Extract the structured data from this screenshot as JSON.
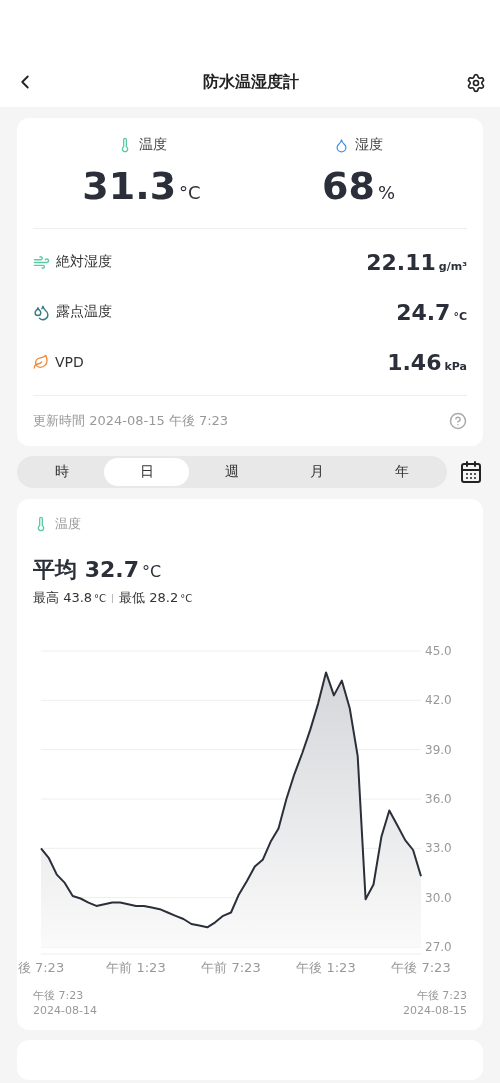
{
  "header": {
    "title": "防水温湿度計"
  },
  "current": [
    {
      "kind": "temperature",
      "label": "温度",
      "value": "31.3",
      "unit": "°C"
    },
    {
      "kind": "humidity",
      "label": "湿度",
      "value": "68",
      "unit": "%"
    }
  ],
  "metrics": [
    {
      "kind": "absolute_humidity",
      "label": "絶対湿度",
      "value": "22.11",
      "unit": "g/m³"
    },
    {
      "kind": "dew_point",
      "label": "露点温度",
      "value": "24.7",
      "unit": "°C"
    },
    {
      "kind": "vpd",
      "label": "VPD",
      "value": "1.46",
      "unit": "kPa"
    }
  ],
  "updated": "更新時間 2024-08-15 午後 7:23",
  "tabs": [
    {
      "label": "時",
      "selected": false
    },
    {
      "label": "日",
      "selected": true
    },
    {
      "label": "週",
      "selected": false
    },
    {
      "label": "月",
      "selected": false
    },
    {
      "label": "年",
      "selected": false
    }
  ],
  "chart_card": {
    "label": "温度",
    "average_label": "平均",
    "average_value": "32.7",
    "average_unit": "°C",
    "max_label": "最高",
    "max_value": "43.8",
    "max_unit": "°C",
    "min_label": "最低",
    "min_value": "28.2",
    "min_unit": "°C",
    "chart_data": {
      "type": "area",
      "grid": true,
      "ylim": [
        27,
        45
      ],
      "categories": [
        "後 7:23",
        null,
        null,
        null,
        null,
        null,
        null,
        null,
        null,
        null,
        null,
        null,
        "午前 1:23",
        null,
        null,
        null,
        null,
        null,
        null,
        null,
        null,
        null,
        null,
        null,
        "午前 7:23",
        null,
        null,
        null,
        null,
        null,
        null,
        null,
        null,
        null,
        null,
        null,
        "午後 1:23",
        null,
        null,
        null,
        null,
        null,
        null,
        null,
        null,
        null,
        null,
        null,
        "午後 7:23"
      ],
      "values": [
        33.0,
        32.4,
        31.4,
        30.9,
        30.1,
        29.95,
        29.7,
        29.5,
        29.6,
        29.7,
        29.7,
        29.6,
        29.5,
        29.5,
        29.4,
        29.3,
        29.1,
        28.9,
        28.7,
        28.4,
        28.3,
        28.2,
        28.5,
        28.9,
        29.1,
        30.2,
        31.0,
        31.9,
        32.3,
        33.4,
        34.2,
        36.0,
        37.5,
        38.8,
        40.2,
        41.8,
        43.7,
        42.3,
        43.2,
        41.5,
        38.6,
        29.9,
        30.8,
        33.7,
        35.3,
        34.4,
        33.5,
        32.9,
        31.3
      ],
      "yticks": [
        {
          "value": 45,
          "label": "45.0"
        },
        {
          "value": 42,
          "label": "42.0"
        },
        {
          "value": 39,
          "label": "39.0"
        },
        {
          "value": 36,
          "label": "36.0"
        },
        {
          "value": 33,
          "label": "33.0"
        },
        {
          "value": 30,
          "label": "30.0"
        },
        {
          "value": 27,
          "label": "27.0"
        }
      ]
    },
    "start": {
      "time": "午後 7:23",
      "date": "2024-08-14"
    },
    "end": {
      "time": "午後 7:23",
      "date": "2024-08-15"
    }
  }
}
